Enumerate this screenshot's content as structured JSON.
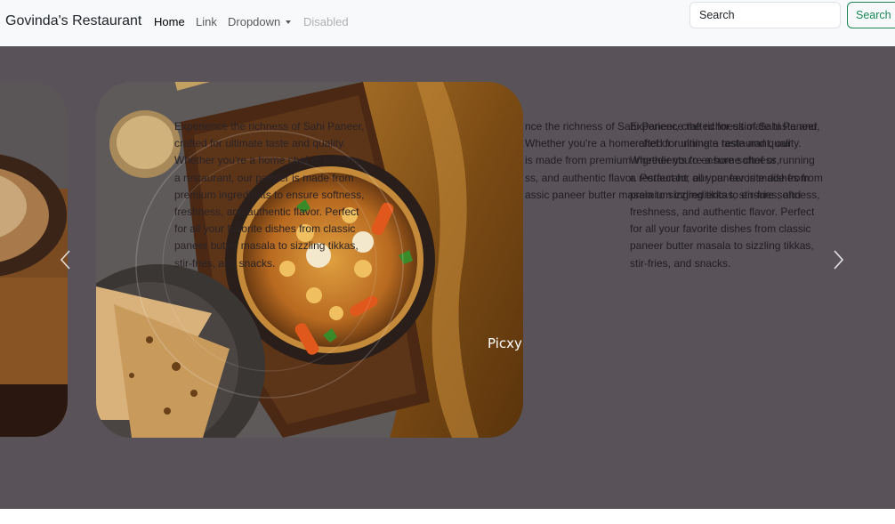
{
  "navbar": {
    "brand": "Govinda's Restaurant",
    "links": [
      {
        "label": "Home"
      },
      {
        "label": "Link"
      },
      {
        "label": "Dropdown"
      },
      {
        "label": "Disabled"
      }
    ],
    "search": {
      "placeholder": "Search",
      "button_label": "Search"
    }
  },
  "carousel": {
    "caption_lines": [
      "Experience the richness of Sahi Paneer,",
      "crafted for ultimate taste and quality.",
      "Whether you're a home chef or running",
      "a restaurant, our paneer is made from",
      "premium ingredients to ensure softness,",
      "freshness, and authentic flavor. Perfect",
      "for all your favorite dishes from classic",
      "paneer butter masala to sizzling tikkas,",
      "stir-fries, and snacks."
    ],
    "overlap_lines": [
      "nce the richness of Sahi Paneer, crafted for ultimate taste and",
      " Whether you're a home chef or running a restaurant, our",
      " is made from premium ingredients to ensure softness,",
      "ss, and authentic flavor. Perfect for all your favorite dishes from",
      "assic paneer butter masala to sizzling tikkas, stir-fries, and"
    ],
    "watermark": "Picxy",
    "prev_label": "Previous",
    "next_label": "Next"
  },
  "colors": {
    "navbar_bg": "#f8f9fa",
    "carousel_bg": "#595359",
    "accent_green": "#198754"
  }
}
